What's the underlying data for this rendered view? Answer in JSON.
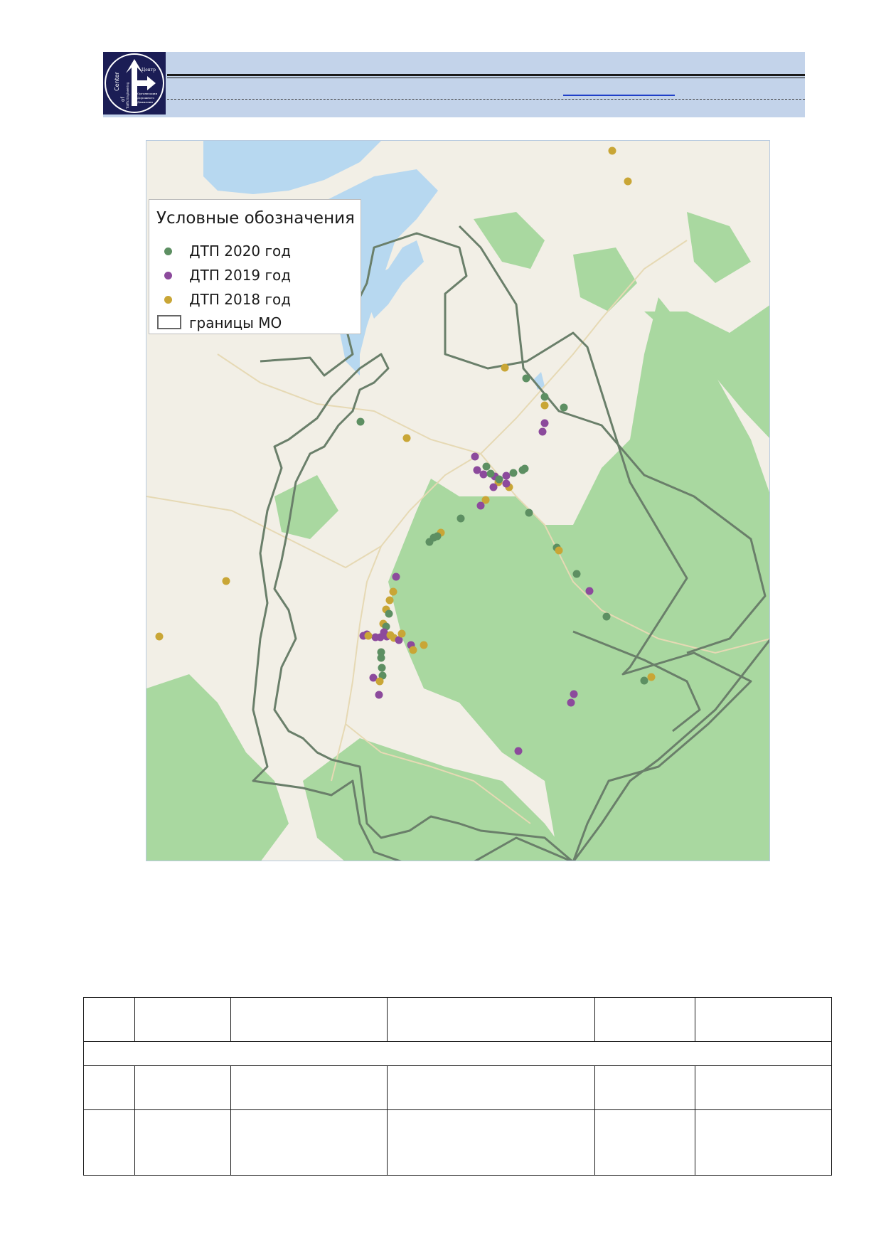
{
  "header": {
    "logo": {
      "text_center": "Center",
      "text_of": "of",
      "text_traffic": "Traffic Engineering",
      "text_centr": "Центр",
      "text_org": "Организации",
      "text_dor": "Дорожного",
      "text_dvizh": "Движения"
    }
  },
  "map": {
    "legend": {
      "title": "Условные обозначения",
      "items": [
        {
          "label": "ДТП 2020 год",
          "color": "#5d8f62"
        },
        {
          "label": "ДТП 2019 год",
          "color": "#8c4a9c"
        },
        {
          "label": "ДТП 2018 год",
          "color": "#c9a636"
        },
        {
          "label": "границы МО",
          "color": "#6b7d6b"
        }
      ]
    },
    "colors": {
      "water": "#b7d8f0",
      "forest": "#a9d8a0",
      "land": "#f2efe6",
      "boundary": "#6a7f6a"
    }
  },
  "table": {
    "rows": [
      [
        "",
        "",
        "",
        "",
        "",
        ""
      ],
      [
        "merged"
      ],
      [
        "",
        "",
        "",
        "",
        "",
        ""
      ],
      [
        "",
        "",
        "",
        "",
        "",
        ""
      ]
    ]
  }
}
